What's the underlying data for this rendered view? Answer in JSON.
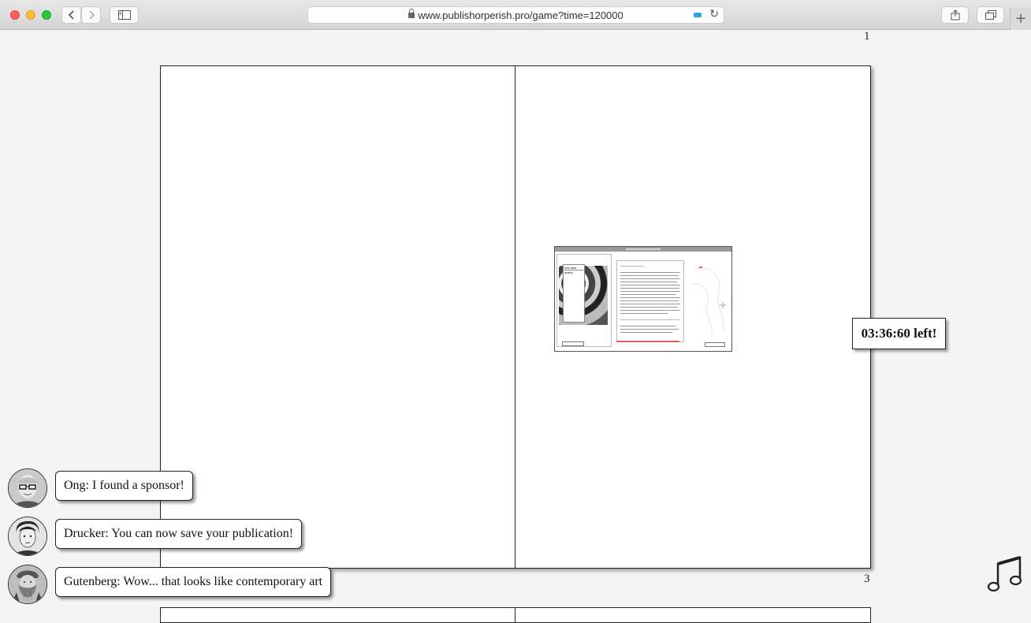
{
  "browser": {
    "url": "www.publishorperish.pro/game?time=120000",
    "back_icon": "chevron-left-icon",
    "forward_icon": "chevron-right-icon",
    "sidebar_icon": "sidebar-icon",
    "share_icon": "share-icon",
    "tabs_icon": "tabs-icon",
    "new_tab_label": "+"
  },
  "page_numbers": {
    "top": "1",
    "bottom": "3"
  },
  "pasted_image": {
    "description_icon": "screenshot-image",
    "sidebar_item_1": "one new",
    "sidebar_item_2": "online"
  },
  "timer": {
    "text": "03:36:60 left!"
  },
  "chat": [
    {
      "speaker_avatar": "ong-avatar",
      "text": "Ong: I found a sponsor!"
    },
    {
      "speaker_avatar": "drucker-avatar",
      "text": "Drucker: You can now save your publication!"
    },
    {
      "speaker_avatar": "gutenberg-avatar",
      "text": "Gutenberg: Wow... that looks like contemporary art"
    }
  ],
  "music_icon": "music-note-icon"
}
